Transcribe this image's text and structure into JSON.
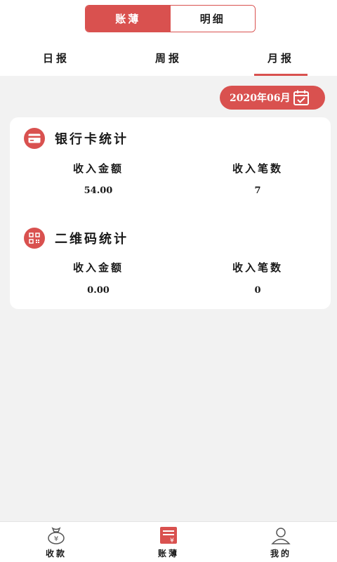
{
  "segments": {
    "left": "账薄",
    "right": "明细"
  },
  "tabs": [
    "日报",
    "周报",
    "月报"
  ],
  "date_picker": {
    "value": "2020年06月"
  },
  "bank_card": {
    "title": "银行卡统计",
    "amount_label": "收入金额",
    "count_label": "收入笔数",
    "amount": "54.00",
    "count": "7"
  },
  "qr_code": {
    "title": "二维码统计",
    "amount_label": "收入金额",
    "count_label": "收入笔数",
    "amount": "0.00",
    "count": "0"
  },
  "bottom_nav": {
    "items": [
      {
        "label": "收款",
        "icon": "money-bag-icon"
      },
      {
        "label": "账薄",
        "icon": "ledger-icon"
      },
      {
        "label": "我的",
        "icon": "user-icon"
      }
    ],
    "active_index": 1
  },
  "colors": {
    "accent": "#d9514f",
    "background": "#f2f2f2"
  }
}
